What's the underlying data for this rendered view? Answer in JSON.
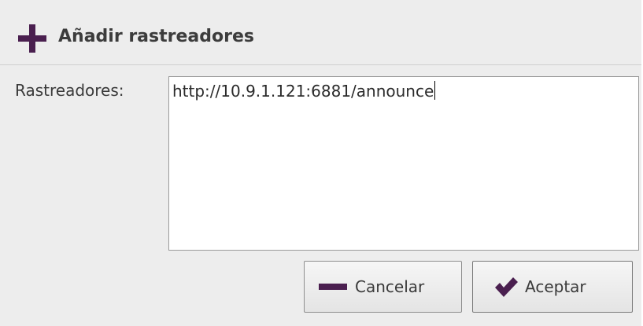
{
  "dialog": {
    "title": "Añadir rastreadores",
    "title_icon": "plus-icon",
    "accent_color": "#4a1f4f"
  },
  "form": {
    "trackers_label": "Rastreadores:",
    "trackers_value": "http://10.9.1.121:6881/announce"
  },
  "buttons": {
    "cancel_label": "Cancelar",
    "cancel_icon": "minus-icon",
    "accept_label": "Aceptar",
    "accept_icon": "checkmark-icon"
  }
}
